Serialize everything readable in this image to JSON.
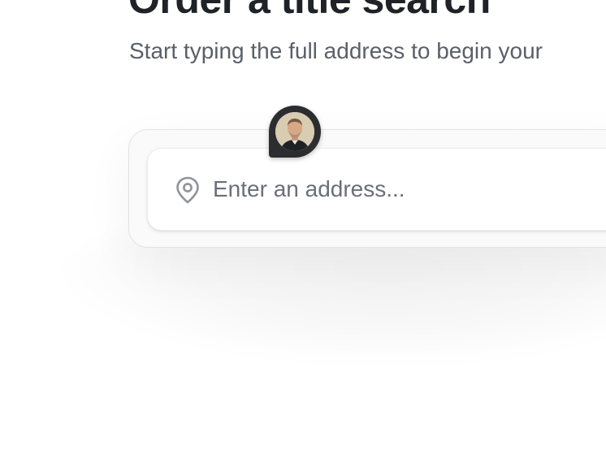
{
  "header": {
    "title": "Order a title search",
    "subtitle": "Start typing the full address to begin your"
  },
  "search": {
    "placeholder": "Enter an address...",
    "value": "",
    "icon": "map-pin-icon"
  },
  "cursor": {
    "avatar": "user-avatar"
  },
  "colors": {
    "title": "#1f2328",
    "subtitle": "#5b6068",
    "placeholder": "#6b6f76",
    "cursor_bg": "#2c2d2f"
  }
}
